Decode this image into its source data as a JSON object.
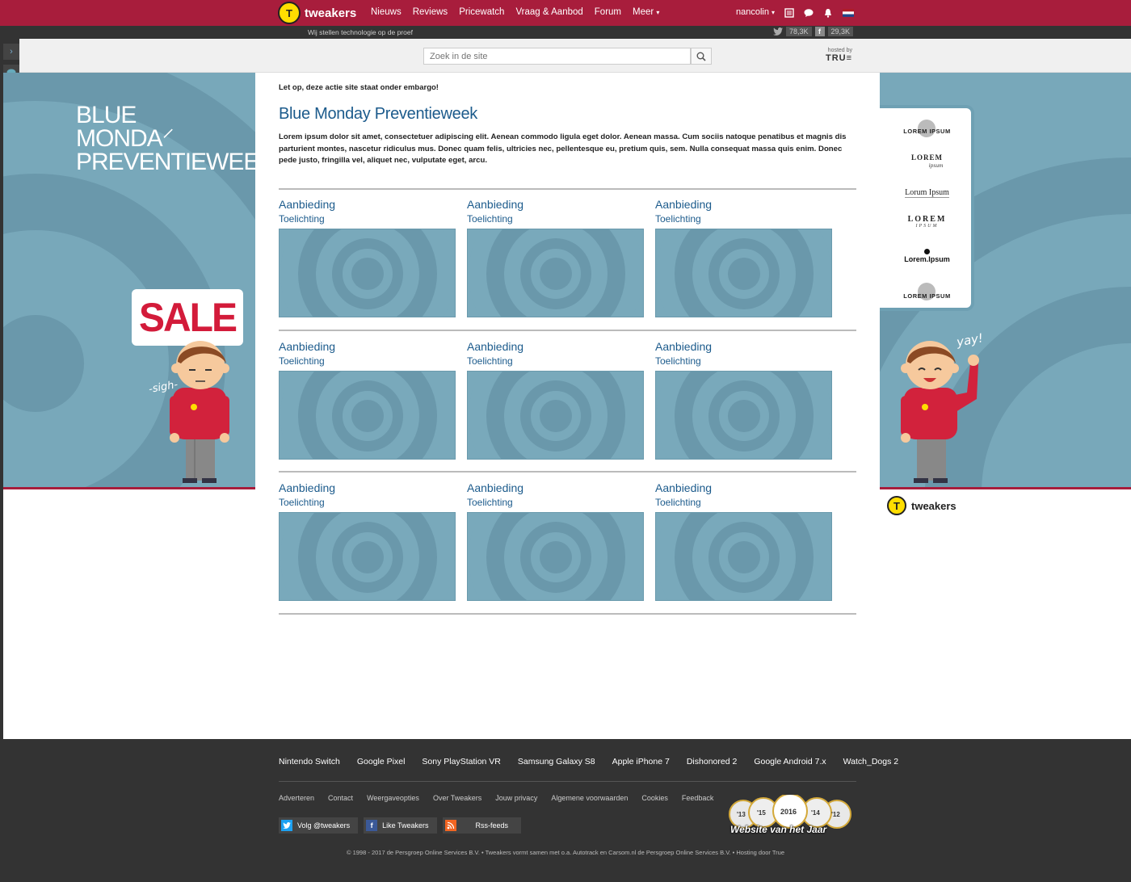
{
  "header": {
    "logo_text": "tweakers",
    "logo_glyph": "T",
    "nav": [
      "Nieuws",
      "Reviews",
      "Pricewatch",
      "Vraag & Aanbod",
      "Forum",
      "Meer"
    ],
    "user": "nancolin",
    "tagline": "Wij stellen technologie op de proef",
    "twitter_count": "78,3K",
    "facebook_count": "29,3K"
  },
  "search": {
    "placeholder": "Zoek in de site",
    "hosted_by": "hosted by",
    "host": "TRU≡"
  },
  "banner_left": {
    "title_lines": [
      "BLUE",
      "MONDA⸍",
      "PREVENTIEWEEK"
    ],
    "sale": "SALE",
    "sigh": "-sigh-"
  },
  "banner_right": {
    "yay": "yay!",
    "logos": [
      "LOREM IPSUM",
      "LOREM",
      "ipsum",
      "Lorum Ipsum",
      "LOREM",
      "IPSUM",
      "Lorem.Ipsum",
      "LOREM IPSUM"
    ],
    "footer_logo": "tweakers"
  },
  "main": {
    "embargo": "Let op, deze actie site staat onder embargo!",
    "title": "Blue Monday Preventieweek",
    "intro": "Lorem ipsum dolor sit amet, consectetuer adipiscing elit. Aenean commodo ligula eget dolor. Aenean massa. Cum sociis natoque penatibus et magnis dis parturient montes, nascetur ridiculus mus. Donec quam felis, ultricies nec, pellentesque eu, pretium quis, sem. Nulla consequat massa quis enim. Donec pede justo, fringilla vel, aliquet nec, vulputate eget, arcu.",
    "offers": [
      {
        "title": "Aanbieding",
        "subtitle": "Toelichting"
      },
      {
        "title": "Aanbieding",
        "subtitle": "Toelichting"
      },
      {
        "title": "Aanbieding",
        "subtitle": "Toelichting"
      },
      {
        "title": "Aanbieding",
        "subtitle": "Toelichting"
      },
      {
        "title": "Aanbieding",
        "subtitle": "Toelichting"
      },
      {
        "title": "Aanbieding",
        "subtitle": "Toelichting"
      },
      {
        "title": "Aanbieding",
        "subtitle": "Toelichting"
      },
      {
        "title": "Aanbieding",
        "subtitle": "Toelichting"
      },
      {
        "title": "Aanbieding",
        "subtitle": "Toelichting"
      }
    ]
  },
  "footer": {
    "tags": [
      "Nintendo Switch",
      "Google Pixel",
      "Sony PlayStation VR",
      "Samsung Galaxy S8",
      "Apple iPhone 7",
      "Dishonored 2",
      "Google Android 7.x",
      "Watch_Dogs 2"
    ],
    "links": [
      "Adverteren",
      "Contact",
      "Weergaveopties",
      "Over Tweakers",
      "Jouw privacy",
      "Algemene voorwaarden",
      "Cookies",
      "Feedback"
    ],
    "buttons": [
      "Volg @tweakers",
      "Like Tweakers",
      "Rss-feeds"
    ],
    "award_years": [
      "'13",
      "'15",
      "2016",
      "'14",
      "'12"
    ],
    "award_text": "Website van het Jaar",
    "copyright": "© 1998 - 2017 de Persgroep Online Services B.V.  •  Tweakers vormt samen met o.a. Autotrack en Carsom.nl de Persgroep Online Services B.V.  •  Hosting door True"
  },
  "colors": {
    "brand_red": "#a81d3c",
    "banner_blue": "#78a8ba",
    "link_blue": "#1c5b8c",
    "logo_yellow": "#ffde00"
  }
}
